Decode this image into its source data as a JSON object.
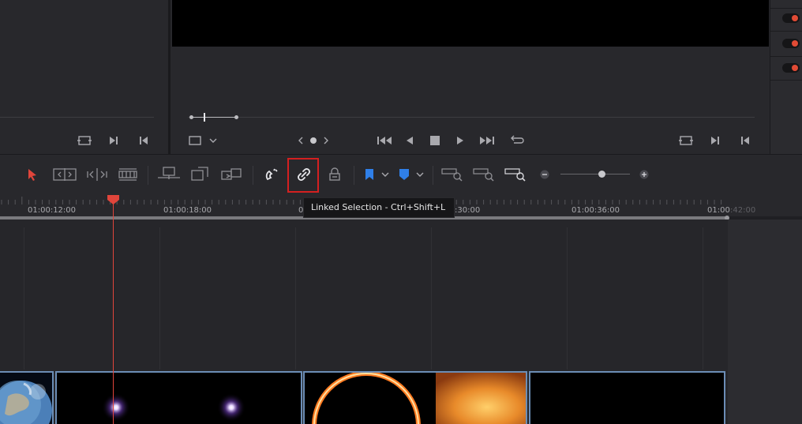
{
  "timeline": {
    "timecodes": [
      "01:00:12:00",
      "01:00:18:00",
      "01:00:30:00",
      "01:00:36:00",
      "01:00:42:00"
    ],
    "timecode_partial_18": "01:00:18:00",
    "timecode_partial_24_prefix": "01",
    "timecode_partial_42_prefix": "01:00",
    "timecode_partial_42_suffix": ":42:00",
    "timecode_30_suffix": ":30:00",
    "clips": [
      "earth",
      "stars",
      "sun-eclipse",
      "black"
    ]
  },
  "tooltip": {
    "text": "Linked Selection - Ctrl+Shift+L"
  },
  "toolbar": {
    "tools": [
      "selection-mode",
      "trim-edit-mode",
      "dynamic-trim-mode",
      "blade-edit-mode",
      "insert-clip",
      "overwrite-clip",
      "replace-clip",
      "snapping",
      "linked-selection",
      "position-lock",
      "flag",
      "marker",
      "full-extent-zoom",
      "detail-zoom",
      "custom-zoom"
    ],
    "zoom_level": 0.5
  },
  "colors": {
    "accent_red": "#e24b35",
    "playhead": "#e0453b",
    "highlight_box": "#d42020",
    "flag_blue": "#2f7fe8",
    "clip_border": "#6b8db5"
  }
}
